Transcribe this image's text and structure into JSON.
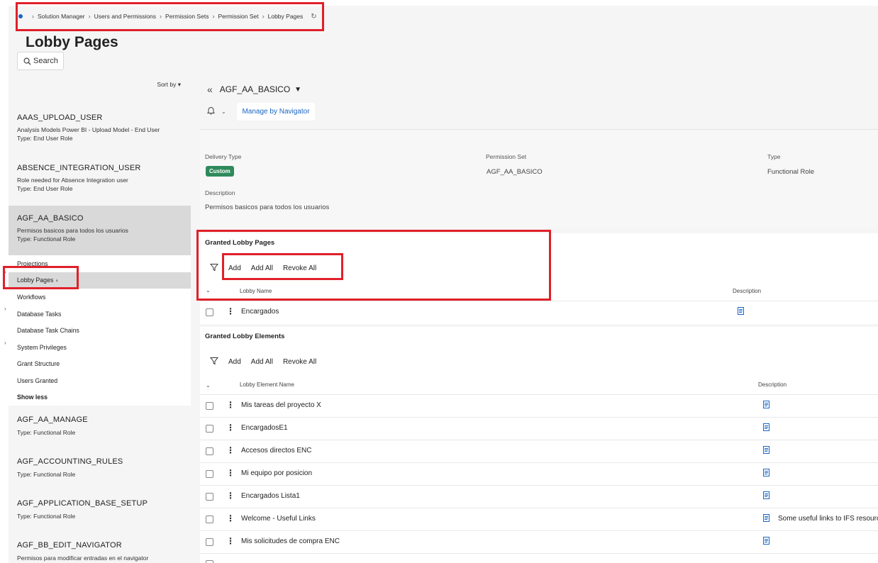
{
  "breadcrumb": {
    "items": [
      "Solution Manager",
      "Users and Permissions",
      "Permission Sets",
      "Permission Set",
      "Lobby Pages"
    ]
  },
  "page": {
    "title": "Lobby Pages"
  },
  "search": {
    "label": "Search"
  },
  "sidebar": {
    "sort_label": "Sort by",
    "roles": [
      {
        "name": "AAAS_UPLOAD_USER",
        "description": "Analysis Models Power BI - Upload Model - End User",
        "type": "Type:   End User Role"
      },
      {
        "name": "ABSENCE_INTEGRATION_USER",
        "description": "Role needed for Absence Integration user",
        "type": "Type:   End User Role"
      },
      {
        "name": "AGF_AA_BASICO",
        "description": "Permisos basicos para todos los usuarios",
        "type": "Type:   Functional Role"
      }
    ],
    "subitems": [
      "Projections",
      "Lobby Pages",
      "Workflows",
      "Database Tasks",
      "Database Task Chains",
      "System Privileges",
      "Grant Structure",
      "Users Granted"
    ],
    "show_less": "Show less",
    "roles_after": [
      {
        "name": "AGF_AA_MANAGE",
        "type": "Type:   Functional Role"
      },
      {
        "name": "AGF_ACCOUNTING_RULES",
        "type": "Type:   Functional Role"
      },
      {
        "name": "AGF_APPLICATION_BASE_SETUP",
        "type": "Type:   Functional Role"
      },
      {
        "name": "AGF_BB_EDIT_NAVIGATOR",
        "description": "Permisos para modificar entradas en el navigator"
      }
    ]
  },
  "record": {
    "name": "AGF_AA_BASICO",
    "manage_button": "Manage by Navigator"
  },
  "details": {
    "delivery_type_label": "Delivery Type",
    "delivery_type_value": "Custom",
    "permission_set_label": "Permission Set",
    "permission_set_value": "AGF_AA_BASICO",
    "type_label": "Type",
    "type_value": "Functional Role",
    "description_label": "Description",
    "description_value": "Permisos basicos para todos los usuarios"
  },
  "granted_pages": {
    "title": "Granted Lobby Pages",
    "actions": {
      "add": "Add",
      "add_all": "Add All",
      "revoke_all": "Revoke All"
    },
    "columns": {
      "name": "Lobby Name",
      "description": "Description"
    },
    "rows": [
      {
        "name": "Encargados"
      }
    ]
  },
  "granted_elements": {
    "title": "Granted Lobby Elements",
    "actions": {
      "add": "Add",
      "add_all": "Add All",
      "revoke_all": "Revoke All"
    },
    "columns": {
      "name": "Lobby Element Name",
      "description": "Description"
    },
    "rows": [
      {
        "name": "Mis tareas del proyecto X",
        "description": ""
      },
      {
        "name": "EncargadosE1",
        "description": ""
      },
      {
        "name": "Accesos directos ENC",
        "description": ""
      },
      {
        "name": "Mi equipo por posicion",
        "description": ""
      },
      {
        "name": "Encargados Lista1",
        "description": ""
      },
      {
        "name": "Welcome - Useful Links",
        "description": "Some useful links to IFS resourc"
      },
      {
        "name": "Mis solicitudes de compra ENC",
        "description": ""
      }
    ]
  },
  "colors": {
    "accent": "#1a66c2",
    "badge": "#2f8a5b",
    "highlight": "#e0202a"
  }
}
